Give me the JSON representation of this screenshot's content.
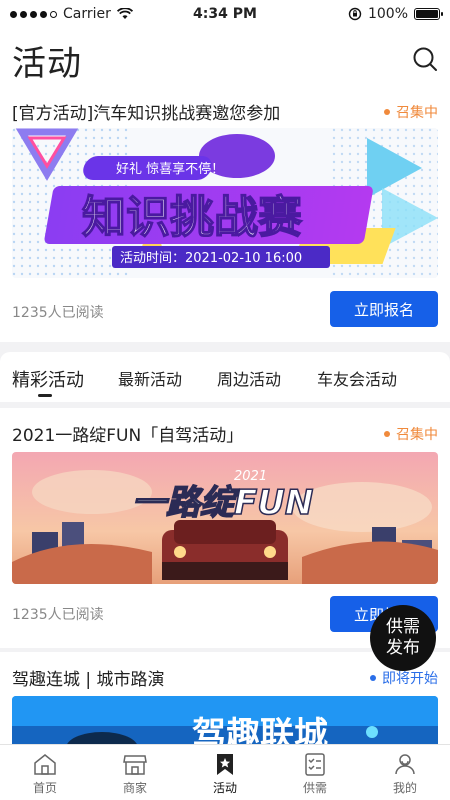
{
  "status_bar": {
    "carrier": "Carrier",
    "time": "4:34 PM",
    "battery": "100%"
  },
  "header": {
    "title": "活动"
  },
  "card1": {
    "title": "[官方活动]汽车知识挑战赛邀您参加",
    "status": "召集中",
    "banner_tag": "好礼 惊喜享不停！",
    "banner_title": "知识挑战赛",
    "banner_time": "活动时间：2021-02-10 16:00",
    "reads": "1235人已阅读",
    "button": "立即报名"
  },
  "tabs": [
    "精彩活动",
    "最新活动",
    "周边活动",
    "车友会活动"
  ],
  "card2": {
    "title": "2021一路绽FUN「自驾活动」",
    "status": "召集中",
    "banner_text": "一路绽FUN",
    "banner_year": "2021",
    "reads": "1235人已阅读",
    "button": "立即报名"
  },
  "card3": {
    "title": "驾趣连城 | 城市路演",
    "status": "即将开始",
    "banner_text": "驾趣联城"
  },
  "fab": {
    "line1": "供需",
    "line2": "发布"
  },
  "tabbar": [
    "首页",
    "商家",
    "活动",
    "供需",
    "我的"
  ],
  "colors": {
    "primary": "#1660e8",
    "status_orange": "#f08a3c",
    "status_blue": "#2a6ee8"
  }
}
